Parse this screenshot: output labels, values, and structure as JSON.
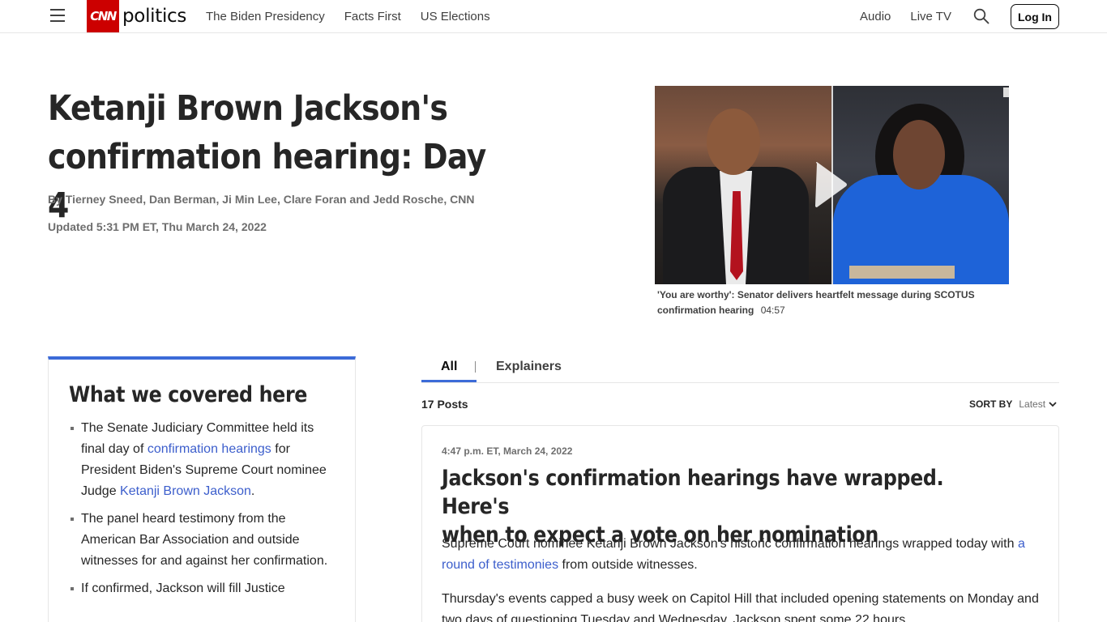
{
  "header": {
    "logo_mark": "CNN",
    "logo_word": "politics",
    "nav_left": [
      "The Biden Presidency",
      "Facts First",
      "US Elections"
    ],
    "nav_right": [
      "Audio",
      "Live TV"
    ],
    "login_label": "Log In"
  },
  "article": {
    "headline_line1": "Ketanji Brown Jackson's",
    "headline_line2": "confirmation hearing: Day 4",
    "byline": "By Tierney Sneed, Dan Berman, Ji Min Lee, Clare Foran and Jedd Rosche, CNN",
    "updated": "Updated 5:31 PM ET, Thu March 24, 2022"
  },
  "video": {
    "caption": "'You are worthy': Senator delivers heartfelt message during SCOTUS confirmation hearing",
    "duration": "04:57"
  },
  "summary": {
    "title": "What we covered here",
    "item1_pre": "The Senate Judiciary Committee held its final day of ",
    "item1_link1": "confirmation hearings",
    "item1_mid": " for President Biden's Supreme Court nominee Judge ",
    "item1_link2": "Ketanji Brown Jackson",
    "item1_post": ".",
    "item2": "The panel heard testimony from the American Bar Association and outside witnesses for and against her confirmation.",
    "item3": "If confirmed, Jackson will fill Justice"
  },
  "tabs": {
    "all": "All",
    "explainers": "Explainers"
  },
  "feed": {
    "posts_count": "17 Posts",
    "sort_label": "SORT BY",
    "sort_value": "Latest"
  },
  "post": {
    "time": "4:47 p.m. ET, March 24, 2022",
    "title_line1": "Jackson's confirmation hearings have wrapped. Here's",
    "title_line2": "when to expect a vote on her nomination",
    "p1_pre": "Supreme Court nominee Ketanji Brown Jackson's historic confirmation hearings wrapped today with ",
    "p1_link": "a round of testimonies",
    "p1_post": " from outside witnesses.",
    "p2": "Thursday's events capped a busy week on Capitol Hill that included opening statements on Monday and two days of questioning Tuesday and Wednesday. Jackson spent some 22 hours"
  },
  "colors": {
    "brand_red": "#cc0000",
    "accent_blue": "#3c6bd8",
    "link_blue": "#3c5ecc"
  }
}
